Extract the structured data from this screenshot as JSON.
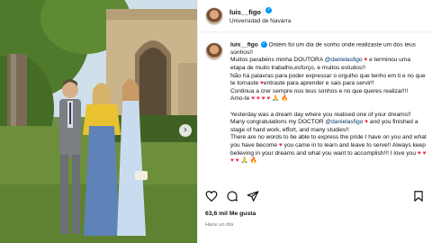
{
  "post": {
    "username": "luis__figo",
    "location": "Universidad de Navarra",
    "likes": "63,6 mil Me gusta",
    "time_ago": "Hace un día"
  },
  "caption": {
    "username": "luis__figo",
    "p1_a": "Ontem foi um dia de sonho onde realizaste um dos teus sonhos!!",
    "p2_a": "Muitos parabéns minha DOUTORA ",
    "p2_mention": "@danielasfigo",
    "p2_heart": " ♥",
    "p2_b": " e terminou uma etapa de muito trabalho,esforço, e muitos estudos!!",
    "p3_a": "Não há palavras para poder expressar o orgulho que tenho em ti e no que te tornaste ",
    "p3_heart": "♥",
    "p3_b": "entraste para aprender e sais para servir!!",
    "p4": "Continua a crer sempre nos teus sonhos e no que queres realizar!!!",
    "p5_a": "Amo-te ",
    "p5_hearts": "♥ ♥ ♥ ♥",
    "p5_emojis": " 🙏 🔥",
    "p6": "Yesterday was a dream day where you realised one of your dreams!!",
    "p7_a": "Many congratulations my DOCTOR ",
    "p7_mention": "@danielasfigo",
    "p7_heart": " ♥",
    "p7_b": " and you finished a stage of hard work, effort, and many studies!!",
    "p8_a": "There are no words to be able to express the pride I have on you and what you have become ",
    "p8_heart": "♥",
    "p8_b": " you came in to learn and leave to serve!! Always keep believing in your dreams and what you want to accomplish!!! I love you ",
    "p8_hearts": "♥ ♥ ♥ ♥",
    "p8_emojis": " 🙏 🔥"
  },
  "icons": {
    "like": "heart-icon",
    "comment": "comment-icon",
    "share": "share-icon",
    "save": "bookmark-icon",
    "next": "chevron-right-icon",
    "verified": "verified-badge-icon"
  },
  "colors": {
    "mention": "#00376b",
    "heart": "#ed2f45",
    "verified": "#0095f6",
    "muted": "#737373"
  }
}
